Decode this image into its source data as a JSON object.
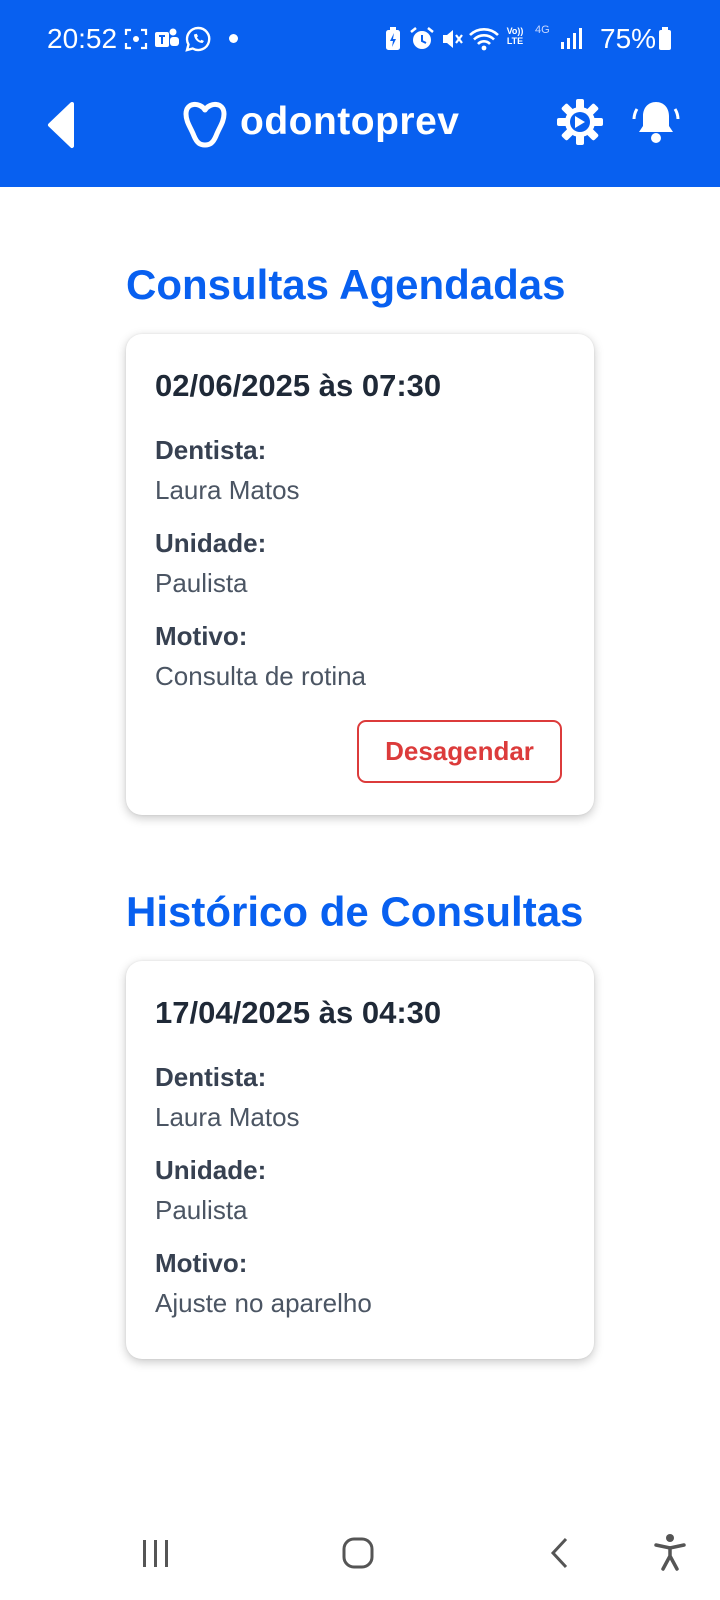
{
  "status_bar": {
    "time": "20:52",
    "battery": "75%",
    "icons": [
      "screenshot-icon",
      "teams-icon",
      "whatsapp-icon",
      "dot-icon",
      "battery-saver-icon",
      "alarm-icon",
      "mute-icon",
      "wifi-icon",
      "volte-icon",
      "4g-icon",
      "signal-icon",
      "battery-icon"
    ],
    "network_label": "4G",
    "volte_label": "Vo)) LTE"
  },
  "app_bar": {
    "brand": "odontoprev",
    "icons": [
      "back-icon",
      "logo-heart-icon",
      "settings-gear-icon",
      "bell-icon"
    ]
  },
  "colors": {
    "primary": "#0860f0",
    "danger": "#dc3b3b",
    "card_bg": "#ffffff",
    "text_dark": "#1f2937"
  },
  "scheduled": {
    "title": "Consultas Agendadas",
    "card": {
      "datetime": "02/06/2025 às 07:30",
      "dentist_label": "Dentista:",
      "dentist": "Laura Matos",
      "unit_label": "Unidade:",
      "unit": "Paulista",
      "reason_label": "Motivo:",
      "reason": "Consulta de rotina",
      "action_label": "Desagendar"
    }
  },
  "history": {
    "title": "Histórico de Consultas",
    "card": {
      "datetime": "17/04/2025 às 04:30",
      "dentist_label": "Dentista:",
      "dentist": "Laura Matos",
      "unit_label": "Unidade:",
      "unit": "Paulista",
      "reason_label": "Motivo:",
      "reason": "Ajuste no aparelho"
    }
  },
  "system_nav": {
    "icons": [
      "recent-apps-icon",
      "home-icon",
      "back-nav-icon",
      "accessibility-icon"
    ]
  }
}
